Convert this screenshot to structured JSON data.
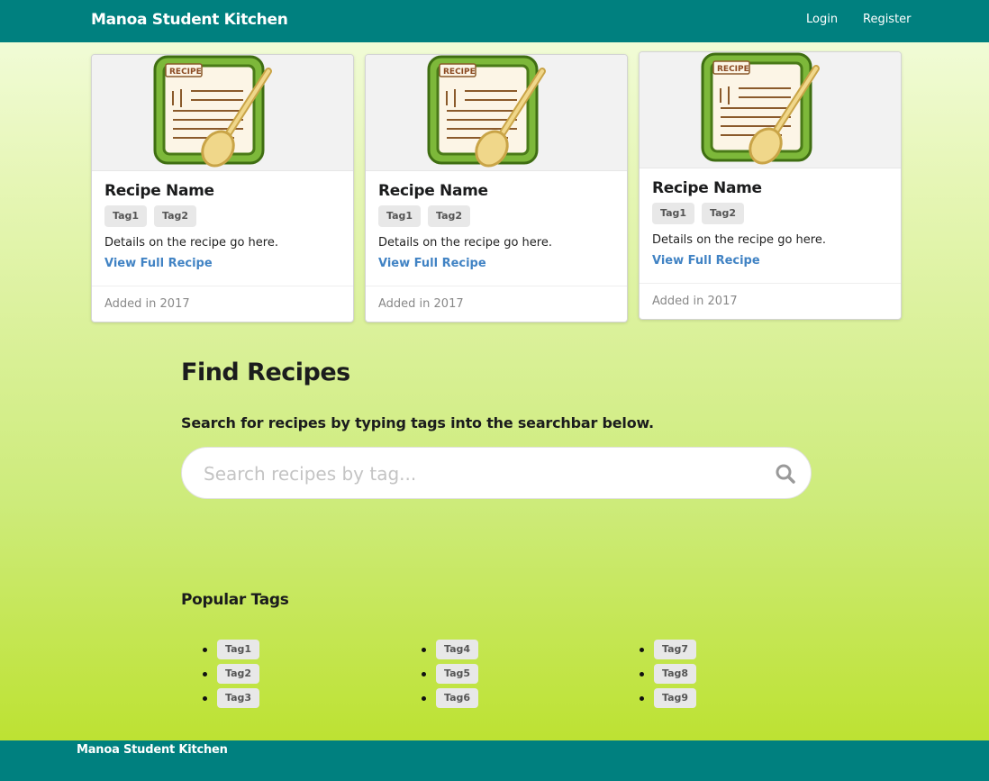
{
  "navbar": {
    "brand": "Manoa Student Kitchen",
    "login": "Login",
    "register": "Register"
  },
  "cards": [
    {
      "image_label": "RECIPE",
      "title": "Recipe Name",
      "tags": [
        "Tag1",
        "Tag2"
      ],
      "description": "Details on the recipe go here.",
      "link": "View Full Recipe",
      "added": "Added in 2017"
    },
    {
      "image_label": "RECIPE",
      "title": "Recipe Name",
      "tags": [
        "Tag1",
        "Tag2"
      ],
      "description": "Details on the recipe go here.",
      "link": "View Full Recipe",
      "added": "Added in 2017"
    },
    {
      "image_label": "RECIPE",
      "title": "Recipe Name",
      "tags": [
        "Tag1",
        "Tag2"
      ],
      "description": "Details on the recipe go here.",
      "link": "View Full Recipe",
      "added": "Added in 2017"
    }
  ],
  "find": {
    "title": "Find Recipes",
    "subtitle": "Search for recipes by typing tags into the searchbar below.",
    "placeholder": "Search recipes by tag...",
    "icon": "search-icon"
  },
  "popular": {
    "title": "Popular Tags",
    "columns": [
      [
        "Tag1",
        "Tag2",
        "Tag3"
      ],
      [
        "Tag4",
        "Tag5",
        "Tag6"
      ],
      [
        "Tag7",
        "Tag8",
        "Tag9"
      ]
    ]
  },
  "footer": {
    "text": "Manoa Student Kitchen"
  },
  "colors": {
    "primary": "#00807f",
    "link": "#4183c4"
  }
}
